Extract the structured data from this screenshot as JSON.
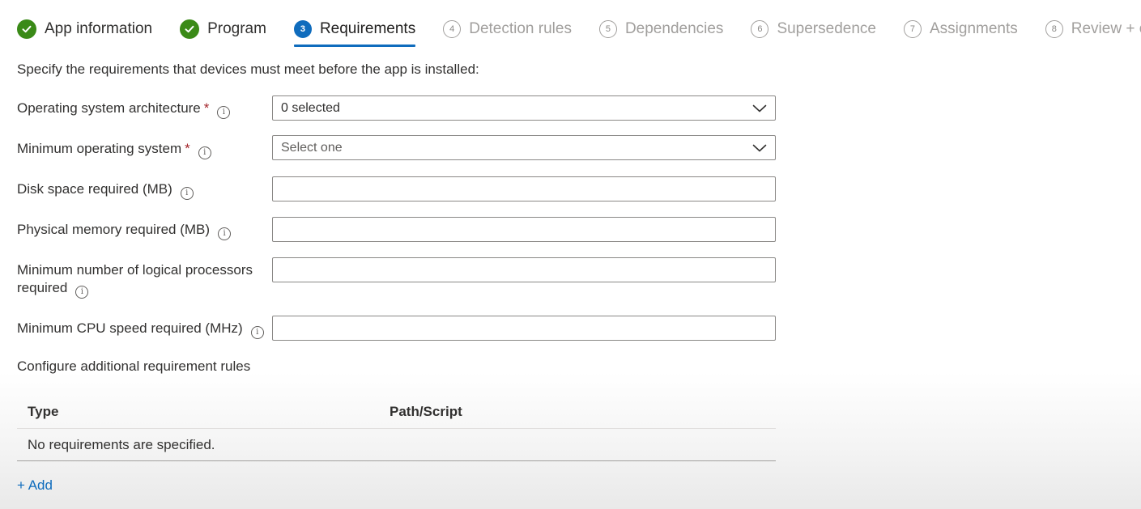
{
  "steps": [
    {
      "num": "1",
      "label": "App information",
      "state": "done"
    },
    {
      "num": "2",
      "label": "Program",
      "state": "done"
    },
    {
      "num": "3",
      "label": "Requirements",
      "state": "current"
    },
    {
      "num": "4",
      "label": "Detection rules",
      "state": "pending"
    },
    {
      "num": "5",
      "label": "Dependencies",
      "state": "pending"
    },
    {
      "num": "6",
      "label": "Supersedence",
      "state": "pending"
    },
    {
      "num": "7",
      "label": "Assignments",
      "state": "pending"
    },
    {
      "num": "8",
      "label": "Review + create",
      "state": "pending"
    }
  ],
  "intro": "Specify the requirements that devices must meet before the app is installed:",
  "form": {
    "os_arch": {
      "label": "Operating system architecture",
      "value": "0 selected"
    },
    "min_os": {
      "label": "Minimum operating system",
      "placeholder": "Select one"
    },
    "disk_space": {
      "label": "Disk space required (MB)",
      "value": ""
    },
    "physical_memory": {
      "label": "Physical memory required (MB)",
      "value": ""
    },
    "logical_processors": {
      "label_line1": "Minimum number of logical processors",
      "label_line2": "required",
      "value": ""
    },
    "cpu_speed": {
      "label": "Minimum CPU speed required (MHz)",
      "value": ""
    },
    "required_marker": "*",
    "info_glyph": "i"
  },
  "rules": {
    "title": "Configure additional requirement rules",
    "columns": [
      "Type",
      "Path/Script"
    ],
    "empty_text": "No requirements are specified.",
    "add_label": "+ Add"
  },
  "colors": {
    "accent": "#0f6cbd",
    "done": "#3a8a17",
    "required": "#a4262c"
  }
}
